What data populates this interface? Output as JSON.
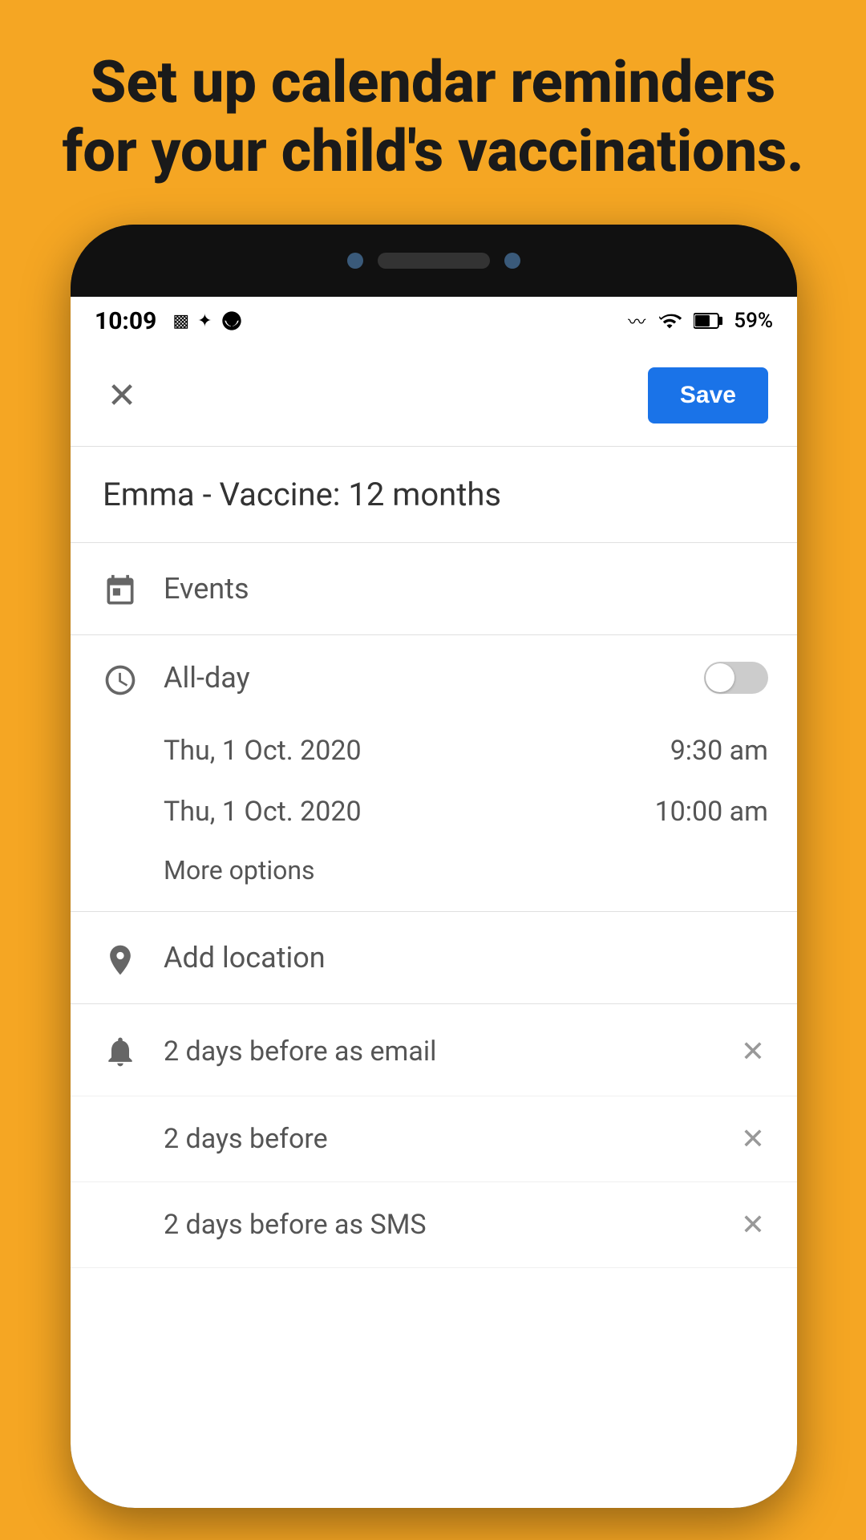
{
  "background_color": "#F5A623",
  "headline": "Set up calendar reminders for your child's vaccinations.",
  "phone": {
    "status_bar": {
      "time": "10:09",
      "battery_percent": "59%"
    }
  },
  "toolbar": {
    "close_label": "×",
    "save_label": "Save"
  },
  "event": {
    "title": "Emma - Vaccine: 12 months"
  },
  "sections": {
    "events_label": "Events",
    "allday_label": "All-day",
    "toggle_state": "off",
    "start_date": "Thu, 1 Oct. 2020",
    "start_time": "9:30 am",
    "end_date": "Thu, 1 Oct. 2020",
    "end_time": "10:00 am",
    "more_options_label": "More options",
    "location_label": "Add location",
    "notifications": [
      {
        "text": "2 days before as email",
        "first": true
      },
      {
        "text": "2 days before",
        "first": false
      },
      {
        "text": "2 days before as SMS",
        "first": false
      }
    ]
  }
}
